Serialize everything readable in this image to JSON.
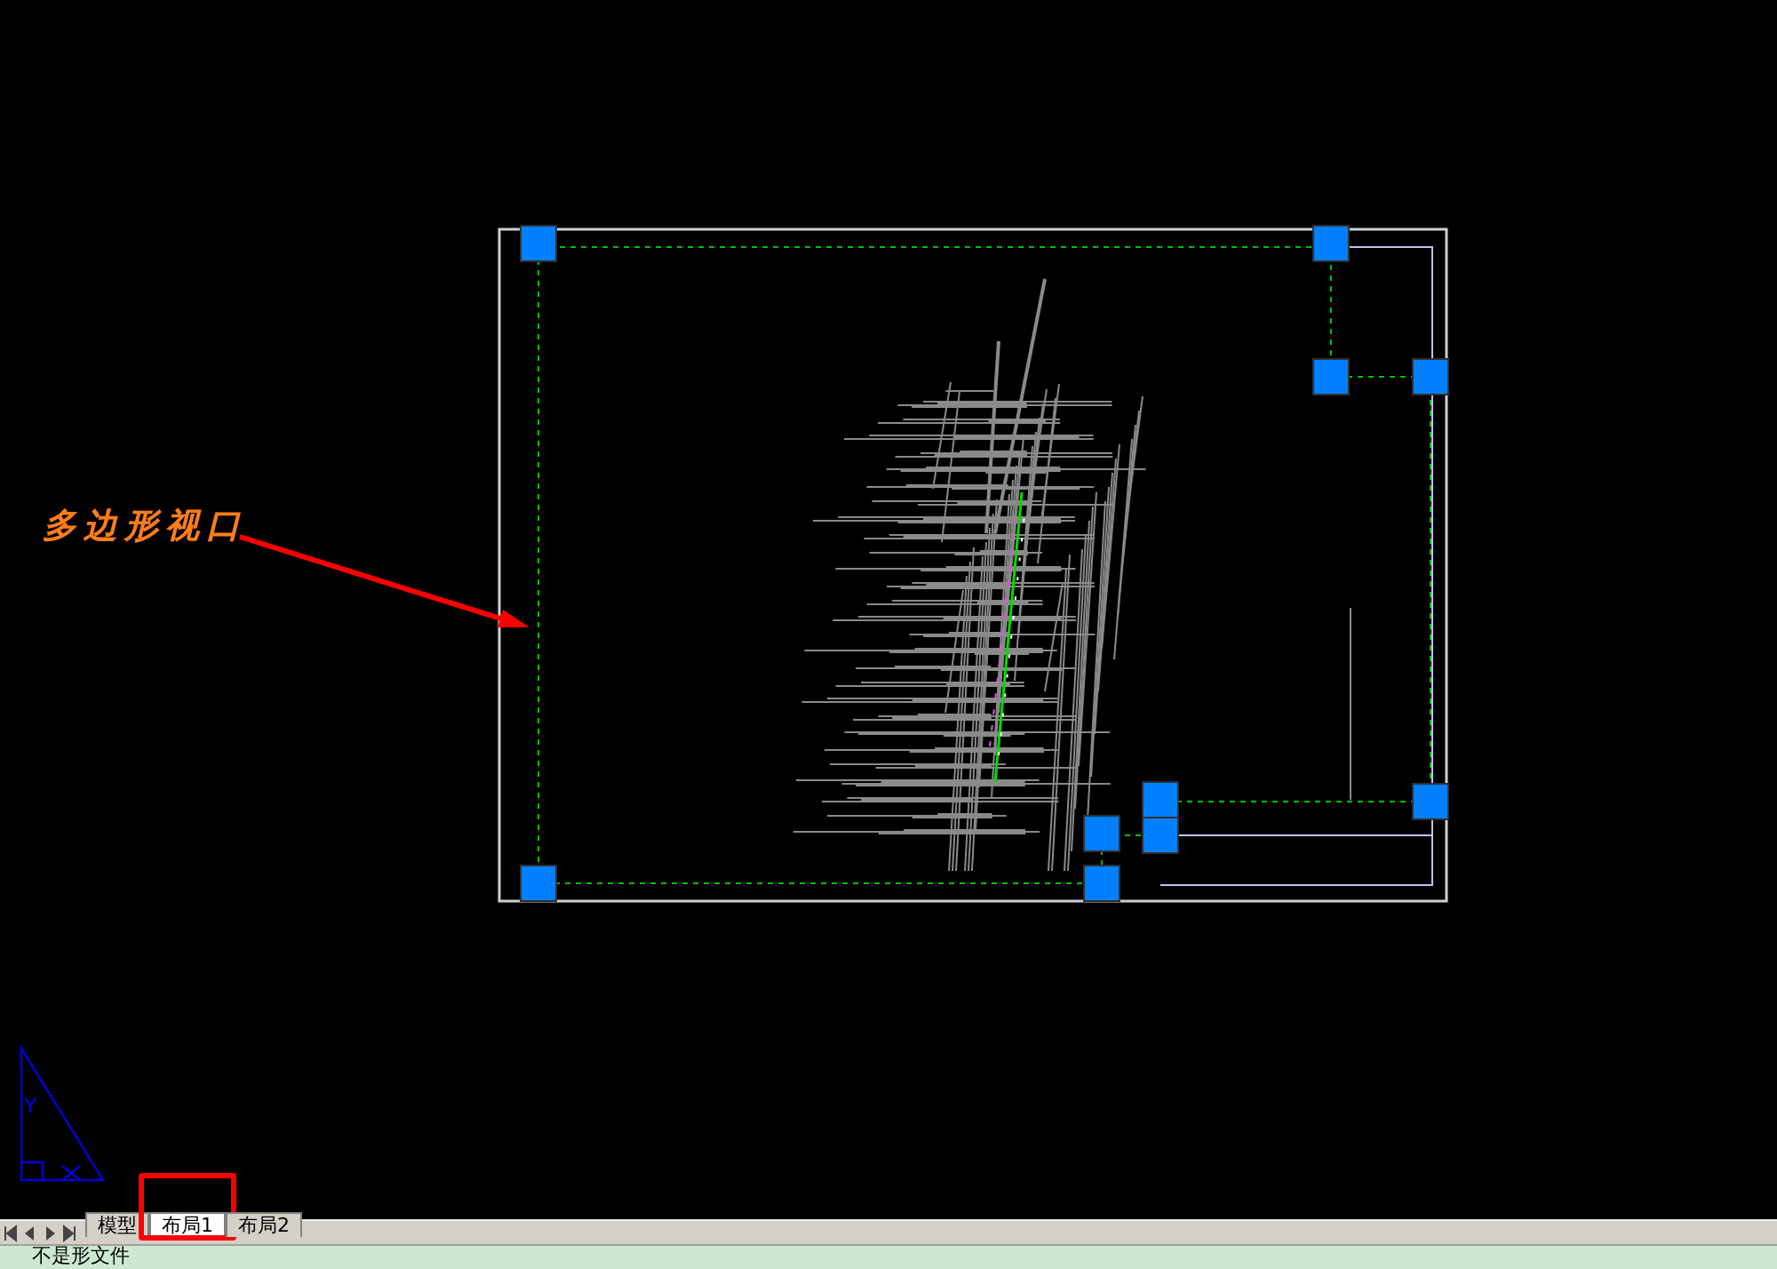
{
  "annotation": {
    "text": "多边形视口"
  },
  "tabs": [
    {
      "label": "模型",
      "selected": false,
      "highlighted": false
    },
    {
      "label": "布局1",
      "selected": true,
      "highlighted": true
    },
    {
      "label": "布局2",
      "selected": false,
      "highlighted": false
    }
  ],
  "status_bar": {
    "text": "不是形文件"
  }
}
